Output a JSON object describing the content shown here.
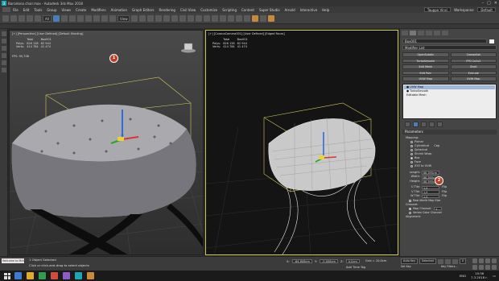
{
  "window": {
    "title": "Barcelona chair.max - Autodesk 3ds Max 2018",
    "controls": [
      "–",
      "□",
      "✕"
    ]
  },
  "menus": [
    "File",
    "Edit",
    "Tools",
    "Group",
    "Views",
    "Create",
    "Modifiers",
    "Animation",
    "Graph Editors",
    "Rendering",
    "Civil View",
    "Customize",
    "Scripting",
    "Content",
    "Super Studio",
    "Arnold",
    "Interactive",
    "Help"
  ],
  "account": {
    "user": "Tauppo Vinci",
    "workspaces_label": "Workspaces:",
    "workspace": "Default"
  },
  "toolbar": {
    "selection_filter": "All",
    "reference": "View"
  },
  "viewport_left": {
    "label": "[+] [Perspective] [User Defined] [Default Shading]",
    "stats_header": [
      "",
      "Total",
      "Box001"
    ],
    "stats_rows": [
      [
        "Polys:",
        "826 128",
        "82 944"
      ],
      [
        "Verts:",
        "414 784",
        "41 474"
      ]
    ],
    "fps_label": "FPS:",
    "fps_value": "90,708"
  },
  "viewport_right": {
    "label": "[+] [CoronaCamera001] [User Defined] [Edged Faces]",
    "stats_header": [
      "",
      "Total",
      "Box001"
    ],
    "stats_rows": [
      [
        "Polys:",
        "826 128",
        "82 944"
      ],
      [
        "Verts:",
        "414 784",
        "41 474"
      ]
    ]
  },
  "command_panel": {
    "object_name": "Box001",
    "object_color": "#f4f4f4",
    "modifier_list": "Modifier List",
    "modifier_buttons": [
      "OpenSubdiv",
      "CreaseSet",
      "TurboSmooth",
      "FFD 2x2x2",
      "Edit Mesh",
      "Shell",
      "Edit Poly",
      "Extrude",
      "UVW Map",
      "UVW Map"
    ],
    "stack": [
      {
        "label": "● UVW Map",
        "selected": true
      },
      {
        "label": "● TurboSmooth",
        "selected": false
      },
      {
        "label": "Editable Mesh",
        "selected": false
      }
    ],
    "parameters": {
      "title": "Parameters",
      "mapping_label": "Mapping:",
      "mapping_options": [
        {
          "label": "Planar",
          "checked": false
        },
        {
          "label": "Cylindrical",
          "checked": false
        },
        {
          "label": "Spherical",
          "checked": false
        },
        {
          "label": "Shrink Wrap",
          "checked": false
        },
        {
          "label": "Box",
          "checked": true
        },
        {
          "label": "Face",
          "checked": false
        },
        {
          "label": "XYZ to UVW",
          "checked": false
        }
      ],
      "cap_label": "Cap",
      "dims": [
        {
          "label": "Length:",
          "value": "88,395cm"
        },
        {
          "label": "Width:",
          "value": "88,395cm"
        },
        {
          "label": "Height:",
          "value": "88,395cm"
        }
      ],
      "tiles": [
        {
          "label": "U Tile:",
          "value": "1,0",
          "flip": "Flip"
        },
        {
          "label": "V Tile:",
          "value": "1,0",
          "flip": "Flip"
        },
        {
          "label": "W Tile:",
          "value": "1,0",
          "flip": "Flip"
        }
      ],
      "real_world": "Real-World Map Size",
      "channel_label": "Channel:",
      "channels": [
        {
          "label": "Map Channel:",
          "value": "1",
          "checked": true
        },
        {
          "label": "Vertex Color Channel",
          "checked": false
        }
      ],
      "alignment_label": "Alignment:"
    }
  },
  "status": {
    "maxscript": "Welcome to MAXScript.",
    "selected": "1 Object Selected",
    "hint": "Click or click-and-drag to select objects",
    "x_label": "X:",
    "x_value": "-64,808cm",
    "y_label": "Y:",
    "y_value": "-5,008cm",
    "z_label": "Z:",
    "z_value": "0,0cm",
    "grid": "Grid = 10,0cm",
    "time_tag": "Add Time Tag",
    "auto_key": "Auto Key",
    "auto_key_mode": "Selected",
    "set_key": "Set Key",
    "key_filters": "Key Filters...",
    "frame": "0"
  },
  "taskbar": {
    "time": "10:56",
    "date": "7.3.2018 г.",
    "lang": "ENG",
    "icon_colors": [
      "#3b7bd1",
      "#e0a92a",
      "#2f9e4f",
      "#d24b3c",
      "#8d5cc4",
      "#1aa6b7",
      "#c8893a"
    ]
  },
  "annotations": [
    {
      "number": "1"
    },
    {
      "number": "2"
    }
  ]
}
